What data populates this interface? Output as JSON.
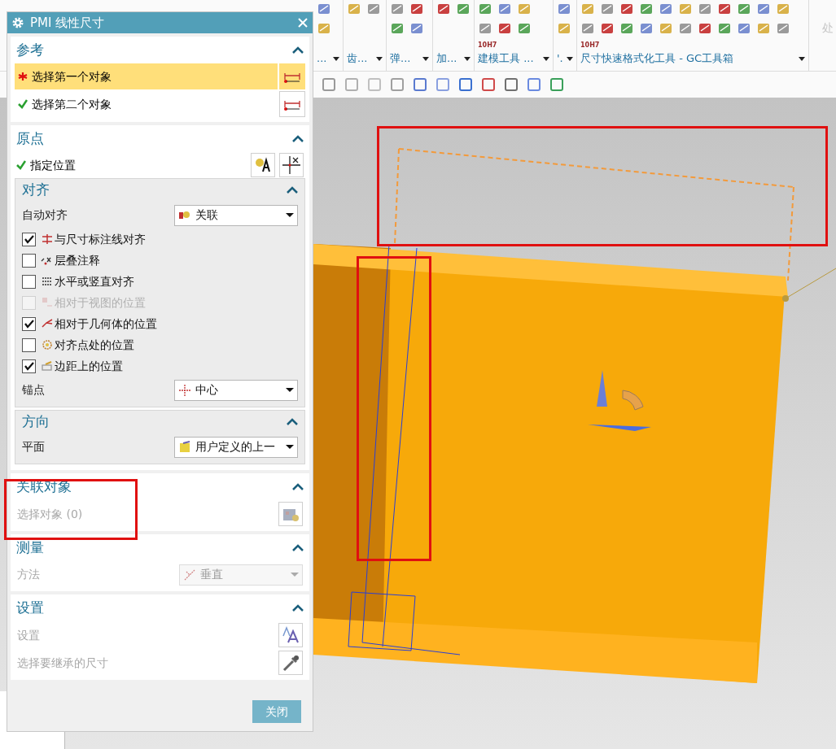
{
  "ribbon": {
    "groups": [
      {
        "label": "..."
      },
      {
        "label": "齿..."
      },
      {
        "label": "弹..."
      },
      {
        "label": "加..."
      },
      {
        "label": "建模工具 ..."
      },
      {
        "label": "'."
      },
      {
        "label": "尺寸快速格式化工具 - GC工具箱"
      }
    ],
    "badges": [
      "10H7",
      "10H7"
    ],
    "cut_label": "处"
  },
  "dialog": {
    "title": "PMI 线性尺寸",
    "sections": [
      {
        "title": "参考",
        "expanded": true,
        "items": [
          {
            "kind": "select",
            "label": "选择第一个对象",
            "selected": true,
            "completed": false
          },
          {
            "kind": "select",
            "label": "选择第二个对象",
            "selected": false,
            "completed": true
          }
        ]
      },
      {
        "title": "原点",
        "expanded": true,
        "items": [
          {
            "kind": "location",
            "label": "指定位置",
            "completed": true
          },
          {
            "kind": "group",
            "title": "对齐",
            "expanded": true,
            "items": [
              {
                "kind": "dropdown",
                "label": "自动对齐",
                "value": "关联",
                "disabled": false
              },
              {
                "kind": "checkbox",
                "label": "与尺寸标注线对齐",
                "checked": true,
                "disabled": false
              },
              {
                "kind": "checkbox",
                "label": "层叠注释",
                "checked": false,
                "disabled": false
              },
              {
                "kind": "checkbox",
                "label": "水平或竖直对齐",
                "checked": false,
                "disabled": false
              },
              {
                "kind": "checkbox",
                "label": "相对于视图的位置",
                "checked": false,
                "disabled": true
              },
              {
                "kind": "checkbox",
                "label": "相对于几何体的位置",
                "checked": true,
                "disabled": false
              },
              {
                "kind": "checkbox",
                "label": "对齐点处的位置",
                "checked": false,
                "disabled": false
              },
              {
                "kind": "checkbox",
                "label": "边距上的位置",
                "checked": true,
                "disabled": false
              },
              {
                "kind": "dropdown",
                "label": "锚点",
                "value": "中心",
                "disabled": false
              }
            ]
          },
          {
            "kind": "group",
            "title": "方向",
            "expanded": true,
            "items": [
              {
                "kind": "dropdown",
                "label": "平面",
                "value": "用户定义的上一",
                "disabled": false
              }
            ]
          }
        ]
      },
      {
        "title": "关联对象",
        "expanded": true,
        "items": [
          {
            "kind": "action",
            "label": "选择对象 (0)"
          }
        ]
      },
      {
        "title": "测量",
        "expanded": true,
        "items": [
          {
            "kind": "dropdown",
            "label": "方法",
            "value": "垂直",
            "disabled": true
          }
        ]
      },
      {
        "title": "设置",
        "expanded": true,
        "items": [
          {
            "kind": "action",
            "label": "设置"
          },
          {
            "kind": "action",
            "label": "选择要继承的尺寸"
          }
        ]
      }
    ],
    "close_button": {
      "label": "关闭"
    }
  }
}
